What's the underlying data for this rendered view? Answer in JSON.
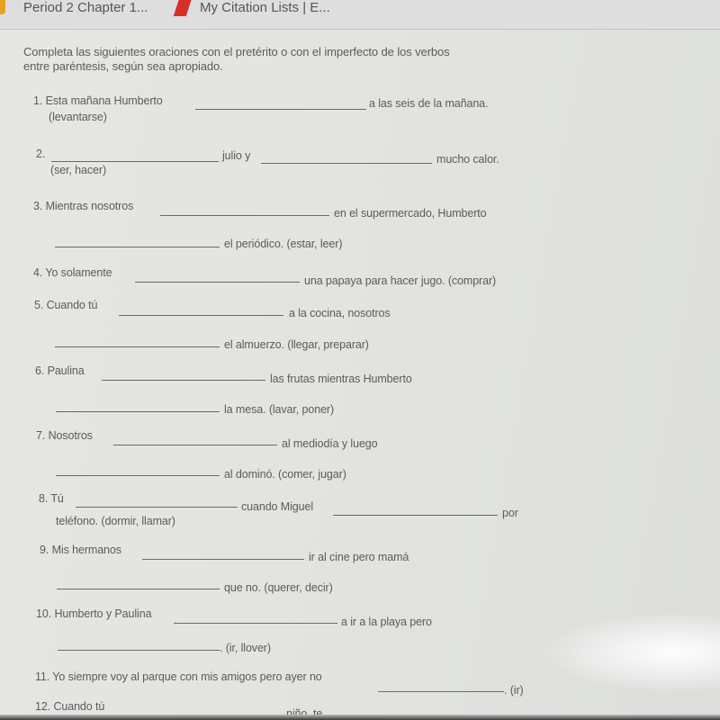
{
  "browser": {
    "tabs": [
      {
        "label": "Period 2 Chapter 1...",
        "icon": "orange-bookmark-icon"
      },
      {
        "label": "My Citation Lists | E...",
        "icon": "red-bookmark-icon",
        "icon_color": "#d6302a"
      }
    ]
  },
  "worksheet": {
    "instructions": [
      "Completa las siguientes oraciones con el pretérito o con el imperfecto de los verbos",
      "entre paréntesis, según sea apropiado."
    ],
    "items": [
      {
        "parts": [
          "1. Esta mañana Humberto",
          "a las seis de la mañana.",
          "(levantarse)"
        ]
      },
      {
        "parts": [
          "2.",
          "julio y",
          "mucho calor.",
          "(ser, hacer)"
        ]
      },
      {
        "parts": [
          "3. Mientras nosotros",
          "en el supermercado, Humberto",
          "el periódico. (estar, leer)"
        ]
      },
      {
        "parts": [
          "4. Yo solamente",
          "una papaya para hacer jugo. (comprar)"
        ]
      },
      {
        "parts": [
          "5. Cuando tú",
          "a la cocina, nosotros",
          "el almuerzo. (llegar, preparar)"
        ]
      },
      {
        "parts": [
          "6. Paulina",
          "las frutas mientras Humberto",
          "la mesa. (lavar, poner)"
        ]
      },
      {
        "parts": [
          "7. Nosotros",
          "al mediodía y luego",
          "al dominó. (comer, jugar)"
        ]
      },
      {
        "parts": [
          "8. Tú",
          "cuando Miguel",
          "por",
          "teléfono. (dormir, llamar)"
        ]
      },
      {
        "parts": [
          "9. Mis hermanos",
          "ir al cine pero mamá",
          "que no. (querer, decir)"
        ]
      },
      {
        "parts": [
          "10. Humberto y Paulina",
          "a ir a la playa pero",
          ". (ir, llover)"
        ]
      },
      {
        "parts": [
          "11. Yo siempre voy al parque con mis amigos pero ayer no",
          ". (ir)"
        ]
      },
      {
        "parts": [
          "12. Cuando tú",
          "niño, te"
        ]
      }
    ]
  }
}
